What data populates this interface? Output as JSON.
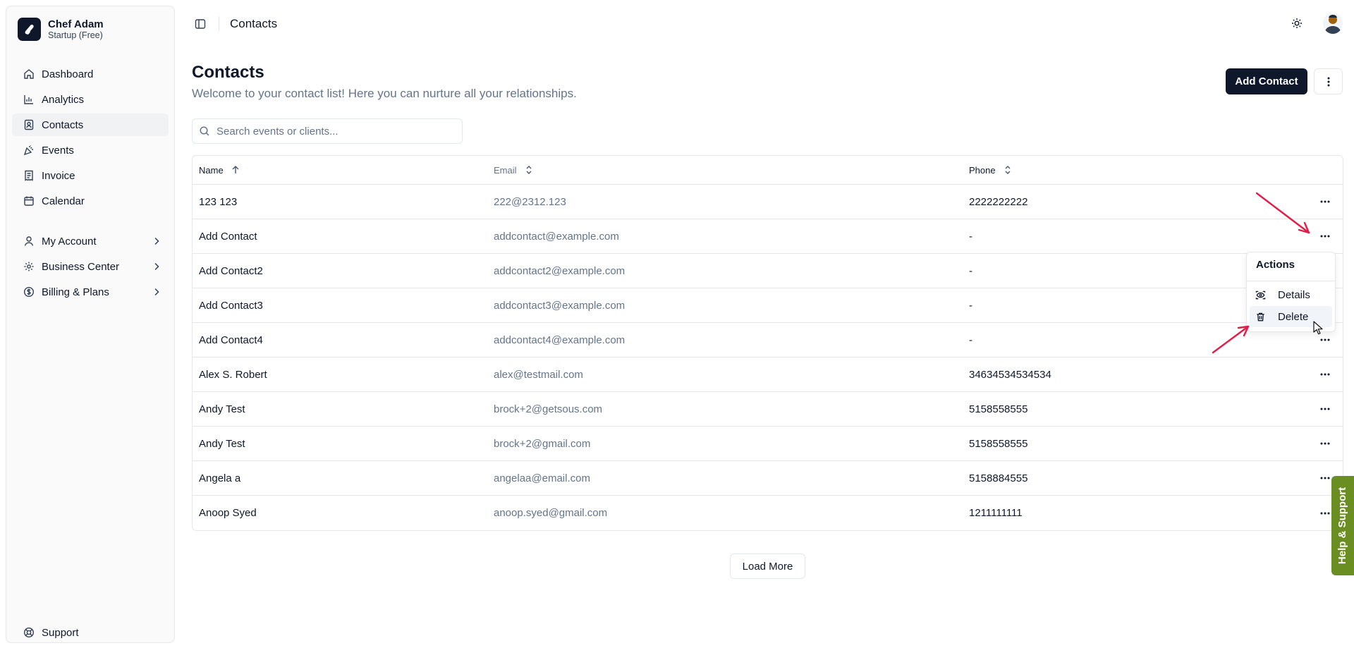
{
  "workspace": {
    "name": "Chef Adam",
    "plan": "Startup (Free)"
  },
  "sidebar": {
    "main": [
      {
        "label": "Dashboard",
        "icon": "home-icon"
      },
      {
        "label": "Analytics",
        "icon": "bar-chart-icon"
      },
      {
        "label": "Contacts",
        "icon": "contact-book-icon",
        "active": true
      },
      {
        "label": "Events",
        "icon": "party-popper-icon"
      },
      {
        "label": "Invoice",
        "icon": "receipt-icon"
      },
      {
        "label": "Calendar",
        "icon": "calendar-icon"
      }
    ],
    "account": [
      {
        "label": "My Account",
        "icon": "user-icon"
      },
      {
        "label": "Business Center",
        "icon": "gear-icon"
      },
      {
        "label": "Billing & Plans",
        "icon": "dollar-circle-icon"
      }
    ],
    "footer": {
      "label": "Support",
      "icon": "lifebuoy-icon"
    }
  },
  "topbar": {
    "breadcrumb": "Contacts"
  },
  "page": {
    "title": "Contacts",
    "subtitle": "Welcome to your contact list! Here you can nurture all your relationships.",
    "add_button": "Add Contact"
  },
  "search": {
    "placeholder": "Search events or clients...",
    "value": ""
  },
  "table": {
    "columns": [
      "Name",
      "Email",
      "Phone"
    ],
    "rows": [
      {
        "name": "123 123",
        "email": "222@2312.123",
        "phone": "2222222222"
      },
      {
        "name": "Add Contact",
        "email": "addcontact@example.com",
        "phone": "-"
      },
      {
        "name": "Add Contact2",
        "email": "addcontact2@example.com",
        "phone": "-"
      },
      {
        "name": "Add Contact3",
        "email": "addcontact3@example.com",
        "phone": "-"
      },
      {
        "name": "Add Contact4",
        "email": "addcontact4@example.com",
        "phone": "-"
      },
      {
        "name": "Alex S. Robert",
        "email": "alex@testmail.com",
        "phone": "34634534534534"
      },
      {
        "name": "Andy Test",
        "email": "brock+2@getsous.com",
        "phone": "5158558555"
      },
      {
        "name": "Andy Test",
        "email": "brock+2@gmail.com",
        "phone": "5158558555"
      },
      {
        "name": "Angela a",
        "email": "angelaa@email.com",
        "phone": "5158884555"
      },
      {
        "name": "Anoop Syed",
        "email": "anoop.syed@gmail.com",
        "phone": "1211111111"
      }
    ]
  },
  "actions_menu": {
    "label": "Actions",
    "items": [
      "Details",
      "Delete"
    ],
    "highlighted": "Delete"
  },
  "load_more": "Load More",
  "help_tab": "Help & Support",
  "colors": {
    "primary": "#0f172a",
    "muted": "#64748b",
    "help_tab": "#6b8e23",
    "annotation_arrow": "#e11d48"
  }
}
